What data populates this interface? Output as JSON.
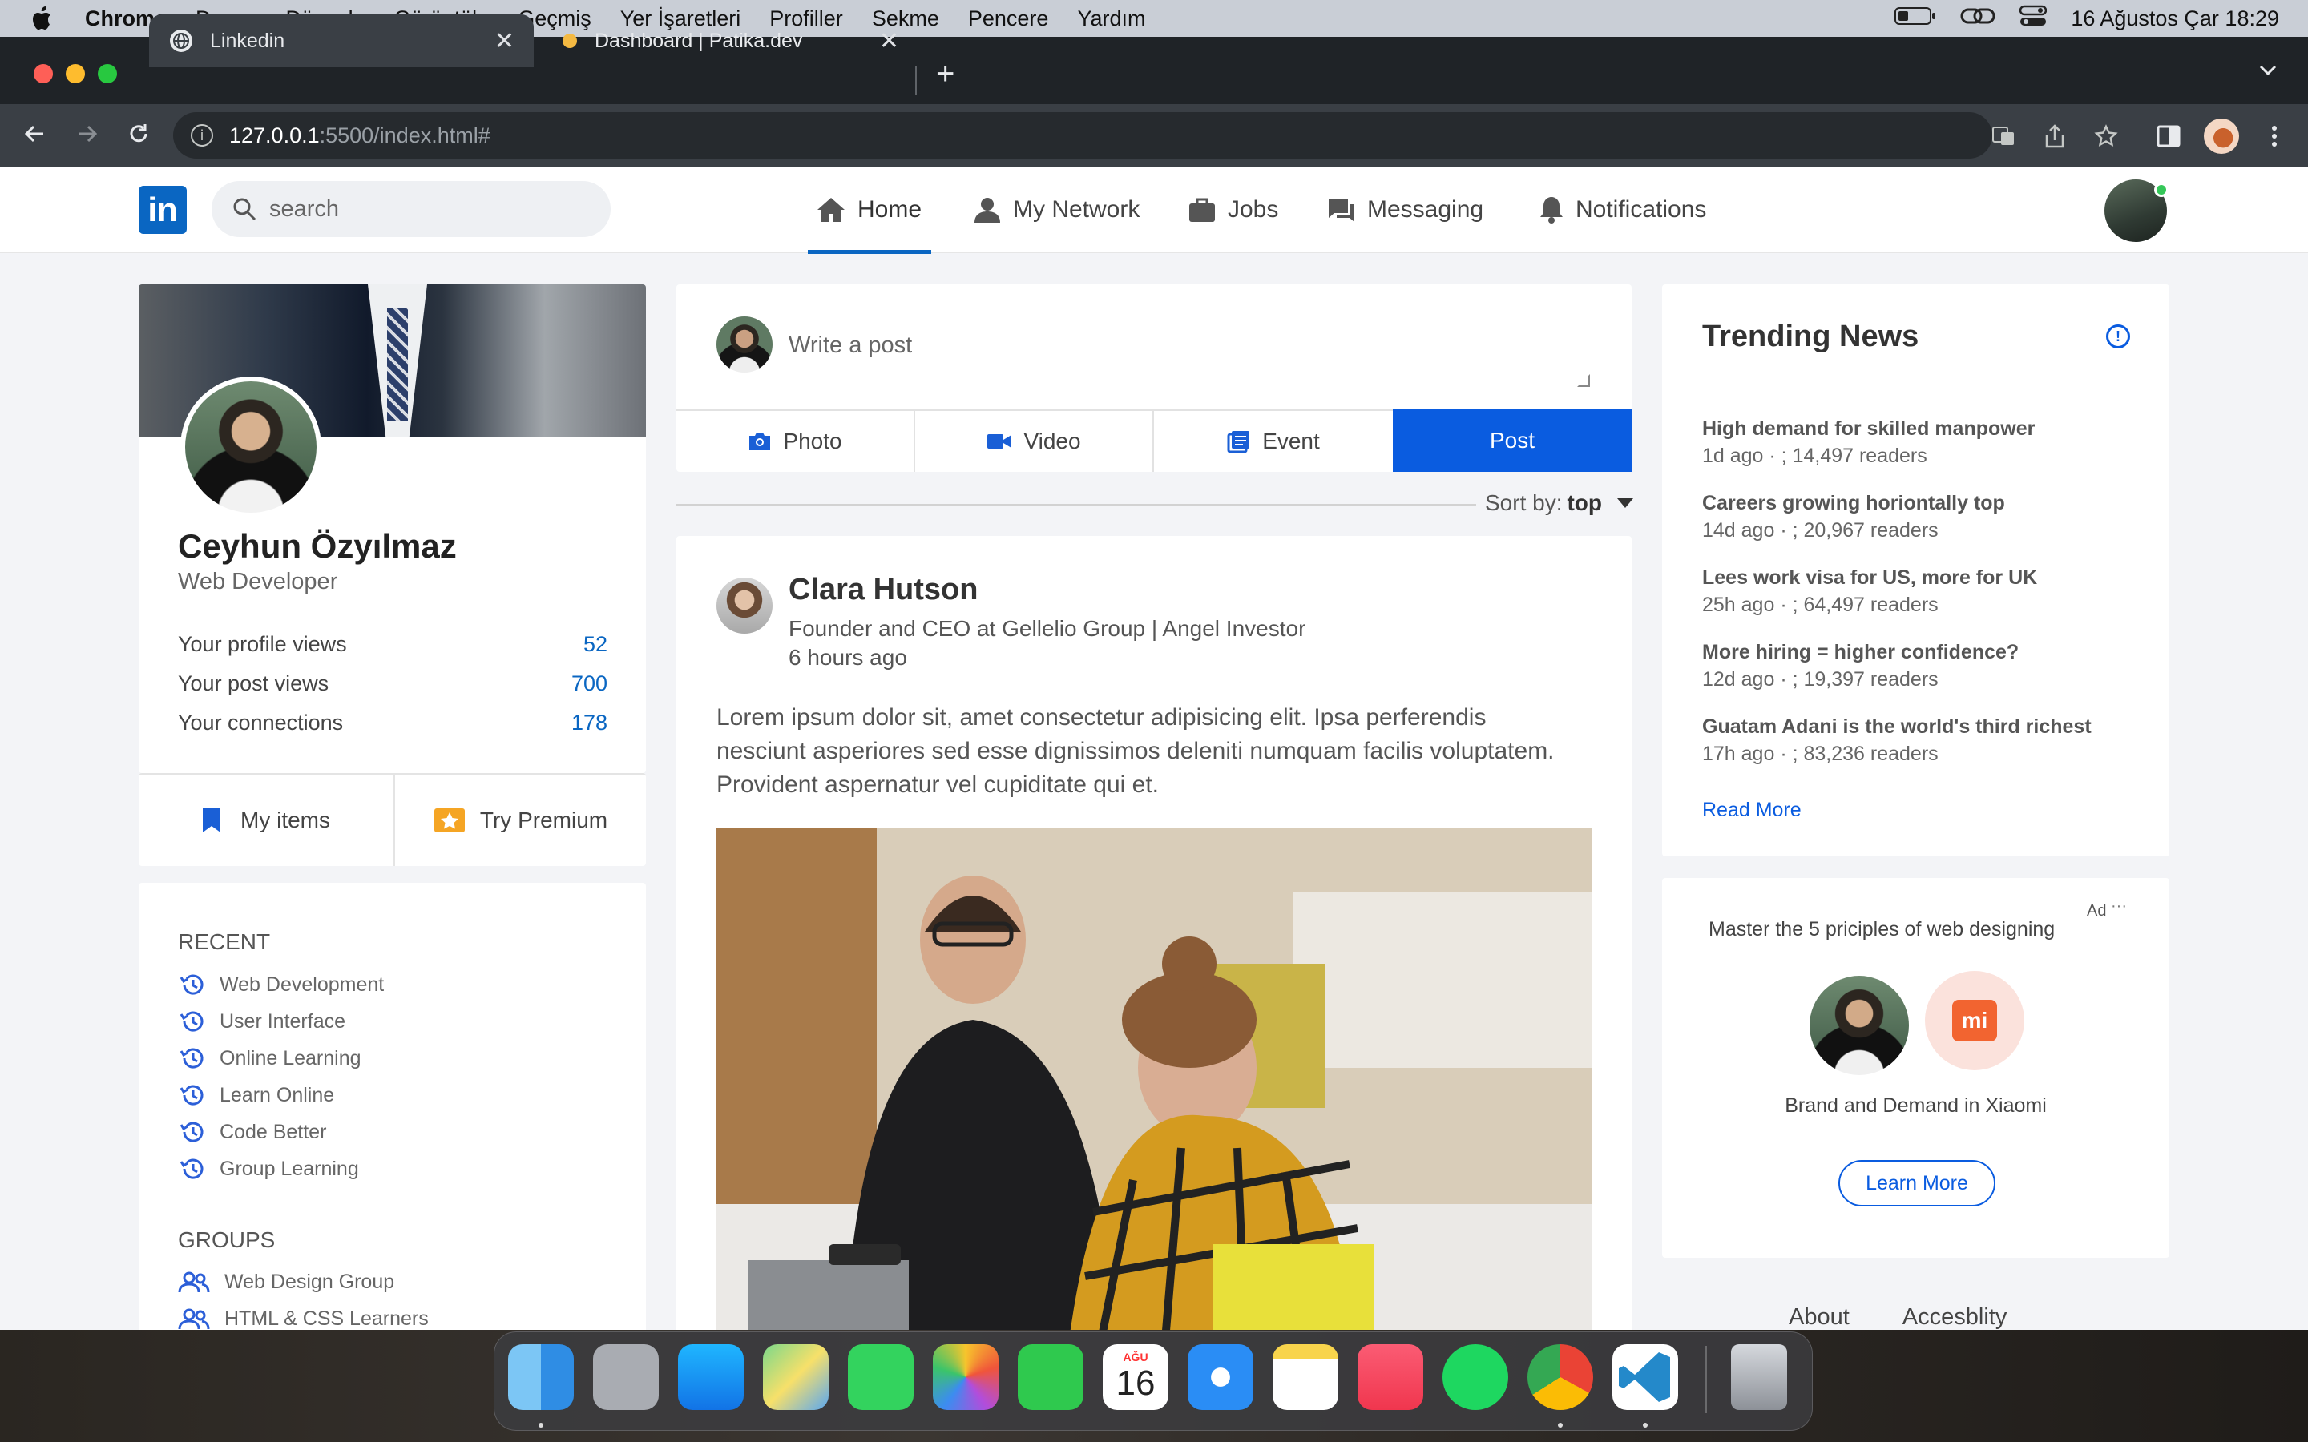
{
  "menubar": {
    "app": "Chrome",
    "items": [
      "Dosya",
      "Düzenle",
      "Görüntüle",
      "Geçmiş",
      "Yer İşaretleri",
      "Profiller",
      "Sekme",
      "Pencere",
      "Yardım"
    ],
    "datetime": "16 Ağustos Çar  18:29"
  },
  "browser": {
    "tabs": [
      {
        "title": "Linkedin",
        "active": true
      },
      {
        "title": "Dashboard | Patika.dev",
        "active": false
      }
    ],
    "url_host": "127.0.0.1",
    "url_path": ":5500/index.html#"
  },
  "nav": {
    "logo": "in",
    "search_placeholder": "search",
    "items": [
      "Home",
      "My Network",
      "Jobs",
      "Messaging",
      "Notifications"
    ]
  },
  "profile": {
    "name": "Ceyhun Özyılmaz",
    "title": "Web Developer",
    "stats": [
      {
        "label": "Your profile views",
        "value": "52"
      },
      {
        "label": "Your post views",
        "value": "700"
      },
      {
        "label": "Your connections",
        "value": "178"
      }
    ],
    "my_items": "My items",
    "premium": "Try Premium"
  },
  "sidebar": {
    "recent_title": "RECENT",
    "recent": [
      "Web Development",
      "User Interface",
      "Online Learning",
      "Learn Online",
      "Code Better",
      "Group Learning"
    ],
    "groups_title": "GROUPS",
    "groups": [
      "Web Design Group",
      "HTML & CSS Learners"
    ]
  },
  "composer": {
    "placeholder": "Write a post",
    "actions": [
      "Photo",
      "Video",
      "Event",
      "Post"
    ]
  },
  "sort": {
    "label": "Sort by:",
    "value": "top"
  },
  "post": {
    "author": "Clara Hutson",
    "subtitle": "Founder and CEO at Gellelio Group | Angel Investor",
    "time": "6 hours ago",
    "body": "Lorem ipsum dolor sit, amet consectetur adipisicing elit. Ipsa perferendis nesciunt asperiores sed esse dignissimos deleniti numquam facilis voluptatem. Provident aspernatur vel cupiditate qui et."
  },
  "trending": {
    "title": "Trending News",
    "items": [
      {
        "headline": "High demand for skilled manpower",
        "meta": "1d ago · ; 14,497 readers"
      },
      {
        "headline": "Careers growing horiontally top",
        "meta": "14d ago · ; 20,967 readers"
      },
      {
        "headline": "Lees work visa for US, more for UK",
        "meta": "25h ago · ; 64,497 readers"
      },
      {
        "headline": "More hiring = higher confidence?",
        "meta": "12d ago · ; 19,397 readers"
      },
      {
        "headline": "Guatam Adani is the world's third richest",
        "meta": "17h ago · ; 83,236 readers"
      }
    ],
    "read_more": "Read More"
  },
  "ad": {
    "label": "Ad",
    "dots": "···",
    "headline": "Master the 5 priciples of web designing",
    "logo_text": "mi",
    "brand": "Brand and Demand in Xiaomi",
    "cta": "Learn More"
  },
  "footer": {
    "links": [
      "About",
      "Accesblity"
    ]
  },
  "dock": {
    "calendar_month": "AĞU",
    "calendar_day": "16"
  },
  "colors": {
    "accent": "#0a5ce0",
    "linkedin": "#0a66c2"
  }
}
